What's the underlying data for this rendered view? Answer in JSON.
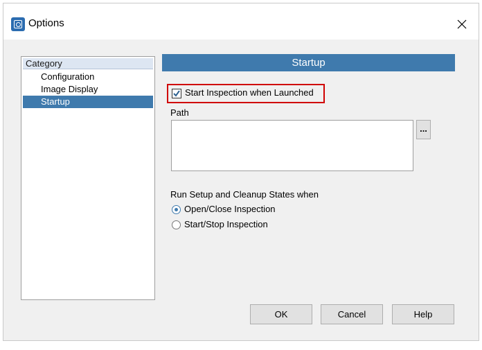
{
  "window": {
    "title": "Options",
    "app_icon": "options-app-icon",
    "close_icon": "close-icon"
  },
  "category": {
    "header": "Category",
    "items": [
      {
        "label": "Configuration",
        "selected": false
      },
      {
        "label": "Image Display",
        "selected": false
      },
      {
        "label": "Startup",
        "selected": true
      }
    ]
  },
  "startup": {
    "section_title": "Startup",
    "start_inspection_label": "Start Inspection when Launched",
    "start_inspection_checked": true,
    "path_label": "Path",
    "path_value": "",
    "browse_label": "...",
    "run_states_label": "Run Setup and Cleanup States when",
    "radio_options": [
      {
        "label": "Open/Close Inspection",
        "selected": true
      },
      {
        "label": "Start/Stop Inspection",
        "selected": false
      }
    ]
  },
  "buttons": {
    "ok": "OK",
    "cancel": "Cancel",
    "help": "Help"
  },
  "colors": {
    "accent": "#3f7aad",
    "highlight": "#d00000"
  }
}
